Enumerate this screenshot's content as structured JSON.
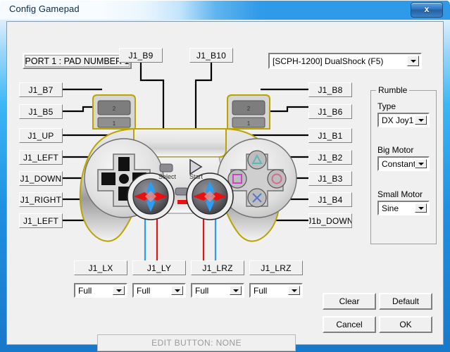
{
  "window": {
    "title": "Config Gamepad",
    "close_label": "x"
  },
  "header": {
    "port_label": "PORT 1 : PAD NUMBER 1",
    "pad_type": "[SCPH-1200] DualShock (F5)"
  },
  "labels_left": [
    {
      "name": "J1_B7"
    },
    {
      "name": "J1_B5"
    },
    {
      "name": "J1_UP"
    },
    {
      "name": "J1_LEFT"
    },
    {
      "name": "J1_DOWN"
    },
    {
      "name": "J1_RIGHT"
    },
    {
      "name": "J1_LEFT"
    }
  ],
  "labels_right": [
    {
      "name": "J1_B8"
    },
    {
      "name": "J1_B6"
    },
    {
      "name": "J1_B1"
    },
    {
      "name": "J1_B2"
    },
    {
      "name": "J1_B3"
    },
    {
      "name": "J1_B4"
    },
    {
      "name": "J1b_DOWN"
    }
  ],
  "labels_top": [
    {
      "name": "J1_B9"
    },
    {
      "name": "J1_B10"
    }
  ],
  "labels_bottom": [
    {
      "name": "J1_LX"
    },
    {
      "name": "J1_LY"
    },
    {
      "name": "J1_LRZ"
    },
    {
      "name": "J1_LRZ"
    }
  ],
  "axis_modes": [
    {
      "value": "Full"
    },
    {
      "value": "Full"
    },
    {
      "value": "Full"
    },
    {
      "value": "Full"
    }
  ],
  "rumble": {
    "legend": "Rumble",
    "type_label": "Type",
    "type_value": "DX Joy1",
    "big_motor_label": "Big Motor",
    "big_motor_value": "Constant",
    "small_motor_label": "Small Motor",
    "small_motor_value": "Sine"
  },
  "buttons": {
    "clear": "Clear",
    "default": "Default",
    "cancel": "Cancel",
    "ok": "OK"
  },
  "status": {
    "text": "EDIT BUTTON: NONE"
  },
  "pad_graphic": {
    "select_label": "Select",
    "start_label": "Start",
    "shoulder_left_top": "2",
    "shoulder_left_bottom": "1",
    "shoulder_right_top": "2",
    "shoulder_right_bottom": "1"
  },
  "colors": {
    "face_triangle": "#5fb8b8",
    "face_square": "#cc44cc",
    "face_circle": "#d46b8f",
    "face_cross": "#5577cc",
    "axis_horizontal": "#e81010",
    "axis_vertical": "#2a9df4",
    "pad_outline": "#bba300"
  }
}
